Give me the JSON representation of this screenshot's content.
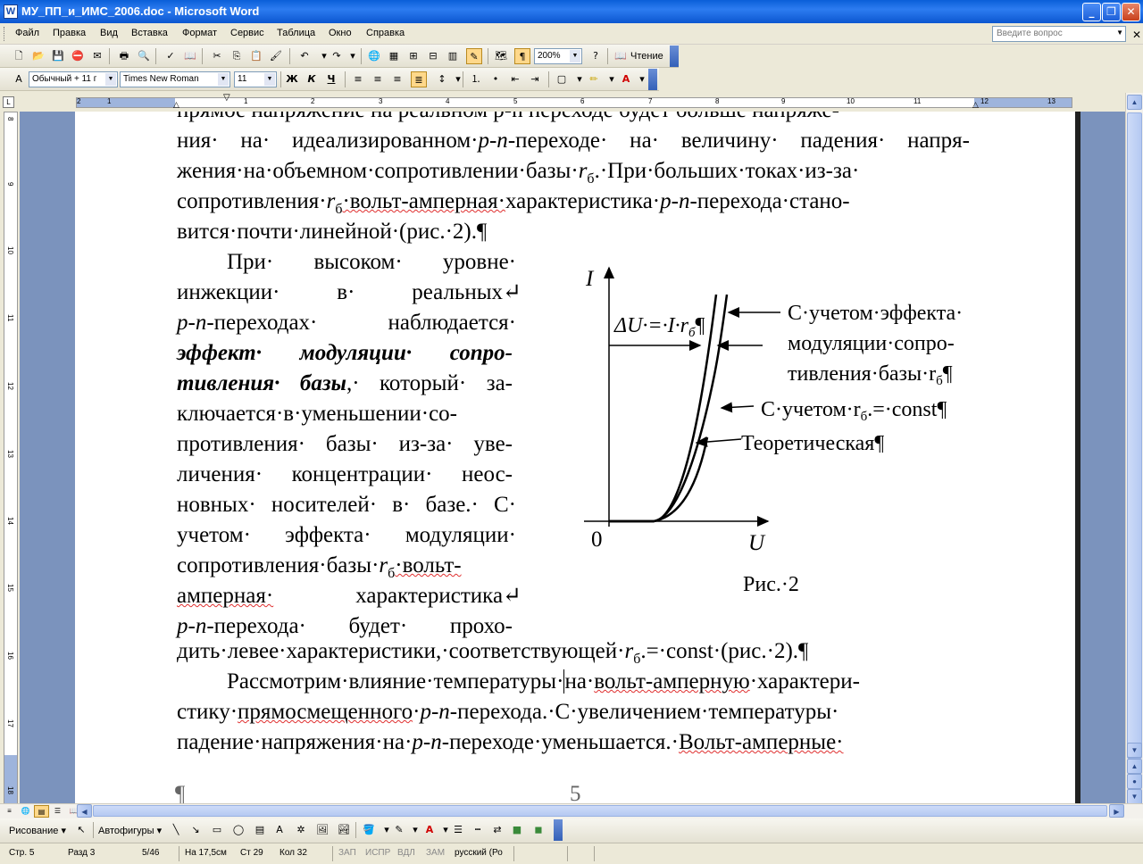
{
  "window": {
    "title": "МУ_ПП_и_ИМС_2006.doc - Microsoft Word",
    "app_icon": "W",
    "controls": [
      "minimize-icon",
      "maximize-icon",
      "close-icon"
    ]
  },
  "menu": {
    "items": [
      "Файл",
      "Правка",
      "Вид",
      "Вставка",
      "Формат",
      "Сервис",
      "Таблица",
      "Окно",
      "Справка"
    ],
    "ask_placeholder": "Введите вопрос"
  },
  "standard_toolbar": {
    "zoom": "200%",
    "reading_label": "Чтение"
  },
  "formatting_toolbar": {
    "style": "Обычный + 11 г",
    "font": "Times New Roman",
    "size": "11",
    "bold": "Ж",
    "italic": "К",
    "underline": "Ч"
  },
  "ruler": {
    "h_numbers": [
      "1",
      "2",
      "1",
      "2",
      "3",
      "4",
      "5",
      "6",
      "7",
      "8",
      "9",
      "10",
      "11",
      "12",
      "13"
    ],
    "v_numbers": [
      "8",
      "9",
      "10",
      "11",
      "12",
      "13",
      "14",
      "15",
      "16",
      "17",
      "18"
    ]
  },
  "document": {
    "line1": "прямое напряжение на реальном p-n переходе будет больше напряже-",
    "line2_a": "ния· на· идеализированном·",
    "line2_pn": "p-n",
    "line2_b": "-переходе· на· величину· падения· напря-",
    "line3_a": "жения·на·объемном·сопротивлении·базы·",
    "line3_r": "r",
    "line3_sub": "б",
    "line3_b": ".·При·больших·токах·из-за·",
    "line4_a": "сопротивления·",
    "line4_r": "r",
    "line4_sub": "б",
    "line4_b": "·вольт-амперная·",
    "line4_c": "характеристика·",
    "line4_pn": "p-n",
    "line4_d": "-перехода·стано-",
    "line5": "вится·почти·линейной·(рис.·2).¶",
    "col": [
      "При· высоком· уровне·",
      "инжекции· в· реальных↵",
      "-переходах· наблюдается·",
      "эффект· модуляции· сопро-",
      "тивления· базы",
      ",· который· за-",
      "ключается·в·уменьшении·со-",
      "противления· базы· из-за· уве-",
      "личения· концентрации· неос-",
      "новных· носителей· в· базе.· С·",
      "учетом· эффекта· модуляции·",
      "сопротивления·базы·",
      "·вольт-",
      "амперная·",
      "характеристика↵",
      "-перехода· будет· прохо-"
    ],
    "col_pn": "p-n",
    "col_r": "r",
    "col_sub": "б",
    "line_after_a": "дить·левее·характеристики,·соответствующей·",
    "line_after_r": "r",
    "line_after_sub": "б",
    "line_after_b": ".=·const·(рис.·2).¶",
    "para2_1_a": "Рассмотрим·влияние·температуры·",
    "para2_1_b": "на·",
    "para2_1_c": "вольт-амперную",
    "para2_1_d": "·характери-",
    "para2_2_a": "стику·",
    "para2_2_b": "прямосмещенного",
    "para2_2_c": "·",
    "para2_2_pn": "p-n",
    "para2_2_d": "-перехода.·С·увеличением·температуры·",
    "para2_3_a": "падение·напряжения·на·",
    "para2_3_pn": "p-n",
    "para2_3_b": "-переходе·уменьшается.·",
    "para2_3_c": "Вольт-амперные·",
    "footer_mark": "¶",
    "page_number": "5"
  },
  "figure": {
    "y_label": "I",
    "x_label": "U",
    "origin": "0",
    "delta_label": "ΔU·=·I·r",
    "delta_sub": "б",
    "delta_mark": "¶",
    "label_mod_1": "С·учетом·эффекта·",
    "label_mod_2": "модуляции·сопро-",
    "label_mod_3": "тивления·базы·r",
    "label_mod_sub": "б",
    "label_mod_mark": "¶",
    "label_const": "С·учетом·r",
    "label_const_sub": "б",
    "label_const_b": ".=·const¶",
    "label_theor": "Теоретическая¶",
    "caption": "Рис.·2"
  },
  "drawing_toolbar": {
    "draw": "Рисование ▾",
    "autoshapes": "Автофигуры ▾"
  },
  "status": {
    "page": "Стр. 5",
    "section": "Разд 3",
    "pages": "5/46",
    "at": "На 17,5см",
    "line": "Ст 29",
    "col": "Кол 32",
    "rec": "ЗАП",
    "trk": "ИСПР",
    "ext": "ВДЛ",
    "ovr": "ЗАМ",
    "lang": "русский (Ро"
  }
}
